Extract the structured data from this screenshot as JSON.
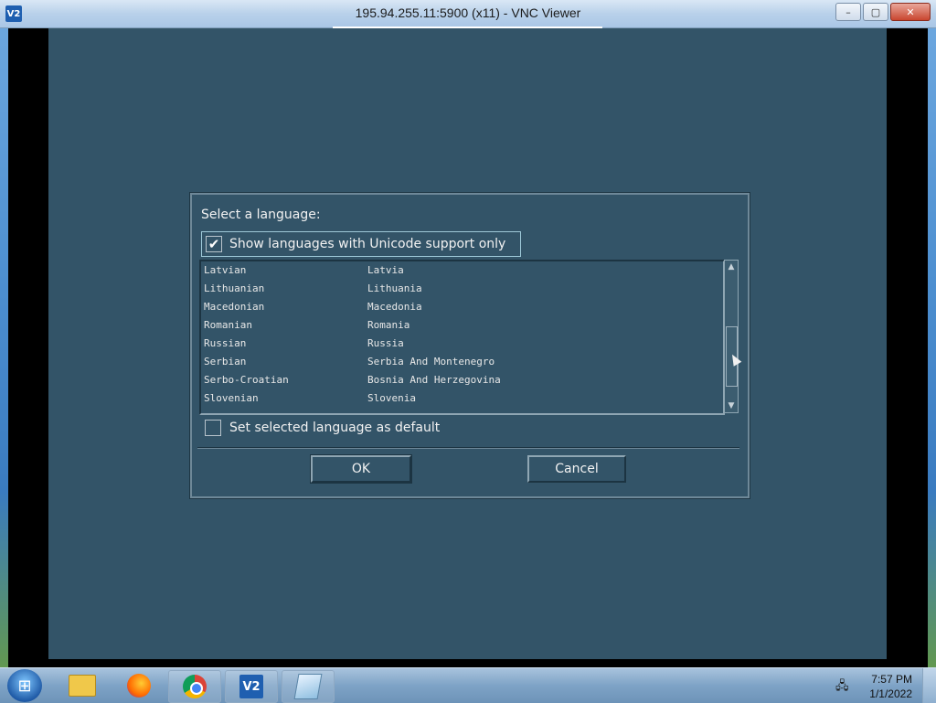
{
  "window": {
    "title": "195.94.255.11:5900 (x11) - VNC Viewer",
    "icon_text": "V2",
    "minimize_label": "–",
    "maximize_label": "▢",
    "close_label": "✕"
  },
  "dialog": {
    "heading": "Select a language:",
    "unicode_only": {
      "label": "Show languages with Unicode support only",
      "checked": true
    },
    "languages": [
      {
        "language": "Latvian",
        "country": "Latvia"
      },
      {
        "language": "Lithuanian",
        "country": "Lithuania"
      },
      {
        "language": "Macedonian",
        "country": "Macedonia"
      },
      {
        "language": "Romanian",
        "country": "Romania"
      },
      {
        "language": "Russian",
        "country": "Russia"
      },
      {
        "language": "Serbian",
        "country": "Serbia And Montenegro"
      },
      {
        "language": "Serbo-Croatian",
        "country": "Bosnia And Herzegovina"
      },
      {
        "language": "Slovenian",
        "country": "Slovenia"
      }
    ],
    "set_default": {
      "label": "Set selected language as default",
      "checked": false
    },
    "ok_label": "OK",
    "cancel_label": "Cancel"
  },
  "taskbar": {
    "apps": [
      "windows-explorer",
      "firefox",
      "chrome",
      "vnc-viewer",
      "notepad"
    ],
    "vnc_icon_text": "V2",
    "clock_time": "7:57 PM",
    "clock_date": "1/1/2022"
  }
}
